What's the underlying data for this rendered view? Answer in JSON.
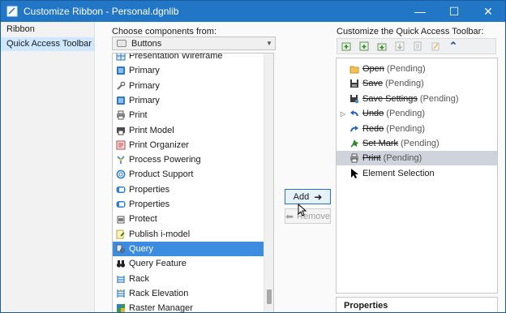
{
  "window": {
    "title": "Customize Ribbon - Personal.dgnlib",
    "minimize_glyph": "—",
    "maximize_glyph": "☐",
    "close_glyph": "✕",
    "titlebar_color": "#2276c6"
  },
  "nav": {
    "items": [
      {
        "label": "Ribbon"
      },
      {
        "label": "Quick Access Toolbar"
      }
    ],
    "selected_index": 1
  },
  "left_panel": {
    "label": "Choose components from:",
    "dropdown": {
      "value": "Buttons",
      "arrow_glyph": "▼"
    },
    "items": [
      {
        "label": "Presentation Wireframe",
        "icon": "wireframe-icon"
      },
      {
        "label": "Primary",
        "icon": "primary-blue-icon"
      },
      {
        "label": "Primary",
        "icon": "wrench-icon"
      },
      {
        "label": "Primary",
        "icon": "primary-blue-icon"
      },
      {
        "label": "Print",
        "icon": "printer-icon"
      },
      {
        "label": "Print Model",
        "icon": "print-model-icon"
      },
      {
        "label": "Print Organizer",
        "icon": "print-organizer-icon"
      },
      {
        "label": "Process Powering",
        "icon": "process-powering-icon"
      },
      {
        "label": "Product Support",
        "icon": "lifebuoy-icon"
      },
      {
        "label": "Properties",
        "icon": "properties-icon"
      },
      {
        "label": "Properties",
        "icon": "properties-icon"
      },
      {
        "label": "Protect",
        "icon": "protect-icon"
      },
      {
        "label": "Publish i-model",
        "icon": "publish-imodel-icon"
      },
      {
        "label": "Query",
        "icon": "query-icon"
      },
      {
        "label": "Query Feature",
        "icon": "binoculars-icon"
      },
      {
        "label": "Rack",
        "icon": "rack-icon"
      },
      {
        "label": "Rack Elevation",
        "icon": "rack-elevation-icon"
      },
      {
        "label": "Raster Manager",
        "icon": "raster-manager-icon"
      }
    ],
    "selected_index": 13,
    "selection_color": "#3c8ce0"
  },
  "buttons": {
    "add": {
      "label": "Add",
      "icon": "arrow-right-icon",
      "glyph": "➜"
    },
    "remove": {
      "label": "Remove",
      "icon": "arrow-left-icon",
      "glyph": "⬅"
    }
  },
  "right_panel": {
    "label": "Customize the Quick Access Toolbar:",
    "toolbar": [
      "add-item-icon",
      "add-group-icon",
      "add-separator-icon",
      "move-down-icon",
      "move-item-icon",
      "edit-icon",
      "collapse-up-icon"
    ],
    "collapse_glyph": "⌃",
    "items": [
      {
        "label": "Open",
        "pending": "(Pending)",
        "icon": "folder-open-icon",
        "struck": true,
        "expandable": false
      },
      {
        "label": "Save",
        "pending": "(Pending)",
        "icon": "save-icon",
        "struck": true,
        "expandable": false
      },
      {
        "label": "Save Settings",
        "pending": "(Pending)",
        "icon": "save-settings-icon",
        "struck": true,
        "expandable": false
      },
      {
        "label": "Undo",
        "pending": "(Pending)",
        "icon": "undo-icon",
        "struck": true,
        "expandable": true
      },
      {
        "label": "Redo",
        "pending": "(Pending)",
        "icon": "redo-icon",
        "struck": true,
        "expandable": false
      },
      {
        "label": "Set Mark",
        "pending": "(Pending)",
        "icon": "set-mark-icon",
        "struck": true,
        "expandable": false
      },
      {
        "label": "Print",
        "pending": "(Pending)",
        "icon": "printer-icon",
        "struck": true,
        "expandable": false
      },
      {
        "label": "Element Selection",
        "pending": "",
        "icon": "arrow-cursor-icon",
        "struck": false,
        "expandable": false
      }
    ],
    "selected_index": 6,
    "expand_glyph": "▷"
  },
  "properties": {
    "title": "Properties"
  }
}
